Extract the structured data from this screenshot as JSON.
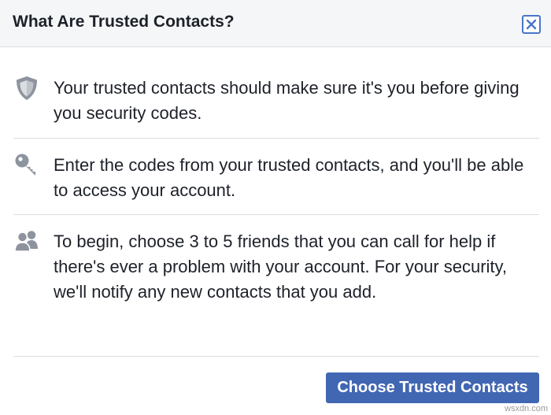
{
  "dialog": {
    "title": "What Are Trusted Contacts?",
    "close_icon": "close-icon",
    "accent_color": "#4267b2"
  },
  "sections": [
    {
      "icon": "shield-icon",
      "text": "Your trusted contacts should make sure it's you before giving you security codes."
    },
    {
      "icon": "key-icon",
      "text": "Enter the codes from your trusted contacts, and you'll be able to access your account."
    },
    {
      "icon": "friends-icon",
      "text": "To begin, choose 3 to 5 friends that you can call for help if there's ever a problem with your account. For your security, we'll notify any new contacts that you add."
    }
  ],
  "footer": {
    "primary_button_label": "Choose Trusted Contacts"
  },
  "watermark": {
    "text": "wsxdn.com"
  }
}
